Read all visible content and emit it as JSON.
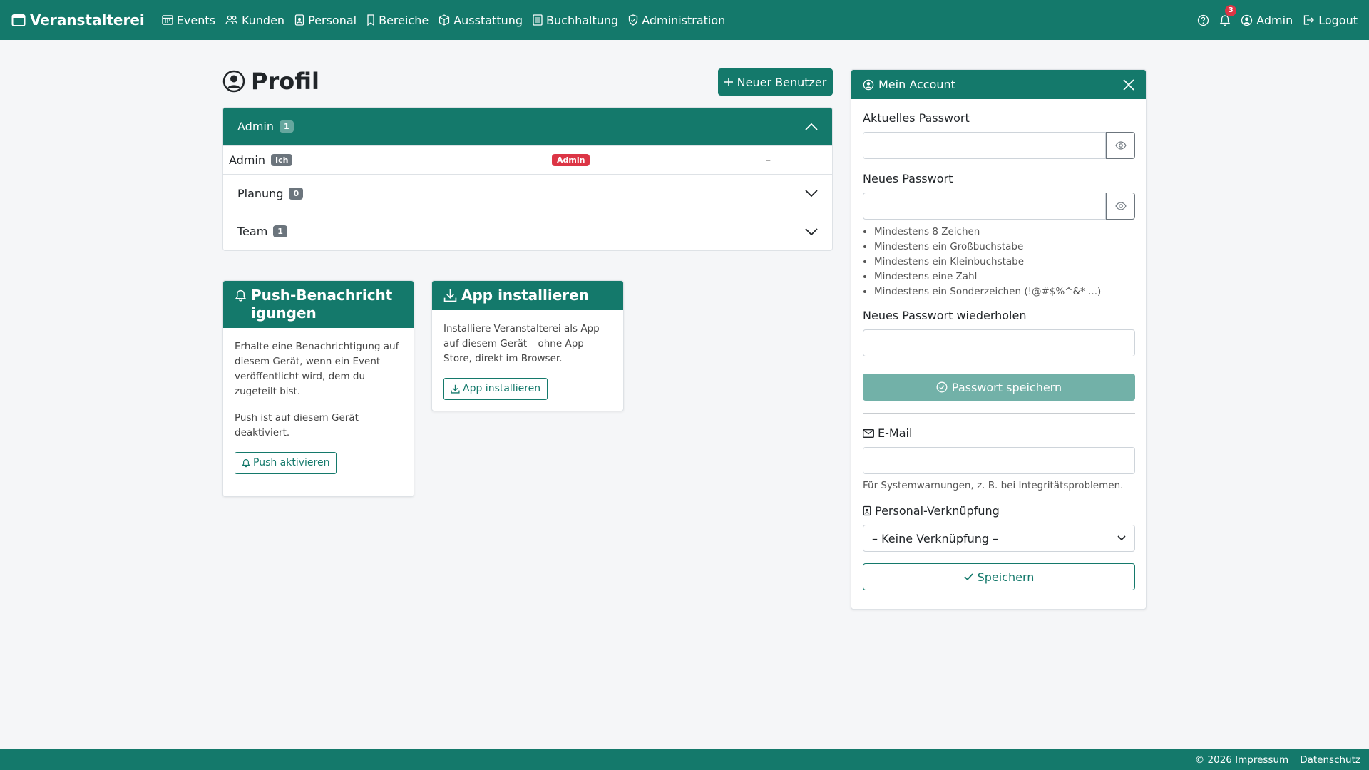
{
  "navbar": {
    "brand": "Veranstalterei",
    "items": [
      {
        "label": "Events",
        "icon": "calendar-grid-icon"
      },
      {
        "label": "Kunden",
        "icon": "people-icon"
      },
      {
        "label": "Personal",
        "icon": "id-badge-icon"
      },
      {
        "label": "Bereiche",
        "icon": "tag-icon"
      },
      {
        "label": "Ausstattung",
        "icon": "box-icon"
      },
      {
        "label": "Buchhaltung",
        "icon": "ledger-icon"
      },
      {
        "label": "Administration",
        "icon": "shield-icon"
      }
    ],
    "notification_count": "3",
    "user_label": "Admin",
    "logout_label": "Logout"
  },
  "page": {
    "title": "Profil",
    "new_user_button": "Neuer Benutzer"
  },
  "accordion": {
    "groups": [
      {
        "name": "Admin",
        "count": "1",
        "open": true
      },
      {
        "name": "Planung",
        "count": "0",
        "open": false
      },
      {
        "name": "Team",
        "count": "1",
        "open": false
      }
    ],
    "admin_row": {
      "username": "Admin",
      "me_badge": "Ich",
      "role_badge": "Admin",
      "link": "–"
    }
  },
  "push_card": {
    "title": "Push-Benachrichtigungen",
    "description": "Erhalte eine Benachrichtigung auf diesem Gerät, wenn ein Event veröffentlicht wird, dem du zugeteilt bist.",
    "status": "Push ist auf diesem Gerät deaktiviert.",
    "button": "Push aktivieren"
  },
  "app_card": {
    "title": "App installieren",
    "description": "Installiere Veranstalterei als App auf diesem Gerät – ohne App Store, direkt im Browser.",
    "button": "App installieren"
  },
  "account": {
    "title": "Mein Account",
    "current_password_label": "Aktuelles Passwort",
    "new_password_label": "Neues Passwort",
    "rules": [
      "Mindestens 8 Zeichen",
      "Mindestens ein Großbuchstabe",
      "Mindestens ein Kleinbuchstabe",
      "Mindestens eine Zahl",
      "Mindestens ein Sonderzeichen (!@#$%^&* ...)"
    ],
    "repeat_password_label": "Neues Passwort wiederholen",
    "save_password_button": "Passwort speichern",
    "email_label": "E-Mail",
    "email_help": "Für Systemwarnungen, z. B. bei Integritätsproblemen.",
    "personal_link_label": "Personal-Verknüpfung",
    "personal_link_value": "– Keine Verknüpfung –",
    "save_button": "Speichern"
  },
  "footer": {
    "copyright": "© 2026 Impressum",
    "privacy": "Datenschutz"
  },
  "colors": {
    "primary": "#14796b",
    "danger": "#dc3545",
    "muted_badge": "#6c757d"
  }
}
